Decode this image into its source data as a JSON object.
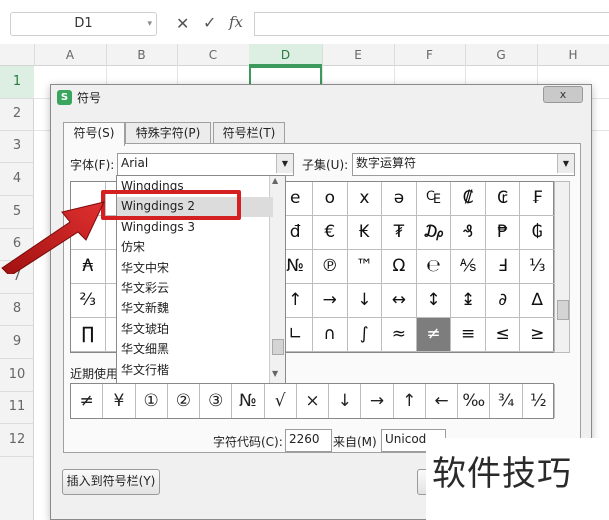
{
  "formula_bar": {
    "name_box": "D1",
    "cancel_icon": "✕",
    "confirm_icon": "✓",
    "fx_label": "fx",
    "formula": ""
  },
  "columns": [
    "A",
    "B",
    "C",
    "D",
    "E",
    "F",
    "G",
    "H"
  ],
  "rows": [
    "1",
    "2",
    "3",
    "4",
    "5",
    "6",
    "7",
    "8",
    "9",
    "10",
    "11",
    "12"
  ],
  "selected_cell": "D1",
  "dialog": {
    "title": "符号",
    "close_label": "x",
    "tabs": [
      "符号(S)",
      "特殊字符(P)",
      "符号栏(T)"
    ],
    "font_label": "字体(F):",
    "font_value": "Arial",
    "subset_label": "子集(U):",
    "subset_value": "数字运算符",
    "symbol_rows": [
      [
        "",
        "",
        "",
        "",
        "",
        "",
        "e",
        "o",
        "x",
        "ə",
        "₠",
        "₡",
        "₢",
        "₣"
      ],
      [
        "",
        "",
        "",
        "",
        "",
        "",
        "đ",
        "€",
        "₭",
        "₮",
        "₯",
        "₰",
        "₱",
        "₲"
      ],
      [
        "₳",
        "",
        "",
        "",
        "",
        "",
        "№",
        "℗",
        "™",
        "Ω",
        "℮",
        "⅍",
        "Ⅎ",
        "⅓"
      ],
      [
        "⅔",
        "",
        "",
        "",
        "",
        "",
        "↑",
        "→",
        "↓",
        "↔",
        "↕",
        "↨",
        "∂",
        "∆"
      ],
      [
        "∏",
        "",
        "",
        "",
        "",
        "",
        "∟",
        "∩",
        "∫",
        "≈",
        "≠",
        "≡",
        "≤",
        "≥"
      ]
    ],
    "selected_symbol": "≠",
    "recent_label": "近期使用",
    "recent_symbols": [
      "≠",
      "¥",
      "①",
      "②",
      "③",
      "№",
      "√",
      "×",
      "↓",
      "→",
      "↑",
      "←",
      "‰",
      "¾",
      "½"
    ],
    "char_code_label": "字符代码(C):",
    "char_code_value": "2260",
    "from_label": "来自(M)",
    "from_value": "Unicod",
    "insert_button": "插入到符号栏(Y)"
  },
  "font_dropdown": {
    "items": [
      "Wingdings",
      "Wingdings 2",
      "Wingdings 3",
      "仿宋",
      "华文中宋",
      "华文彩云",
      "华文新魏",
      "华文琥珀",
      "华文细黑",
      "华文行楷"
    ],
    "highlighted": "Wingdings 2"
  },
  "watermark": "软件技巧",
  "colors": {
    "accent_green": "#3c9a5c",
    "highlight_red": "#d42020"
  }
}
